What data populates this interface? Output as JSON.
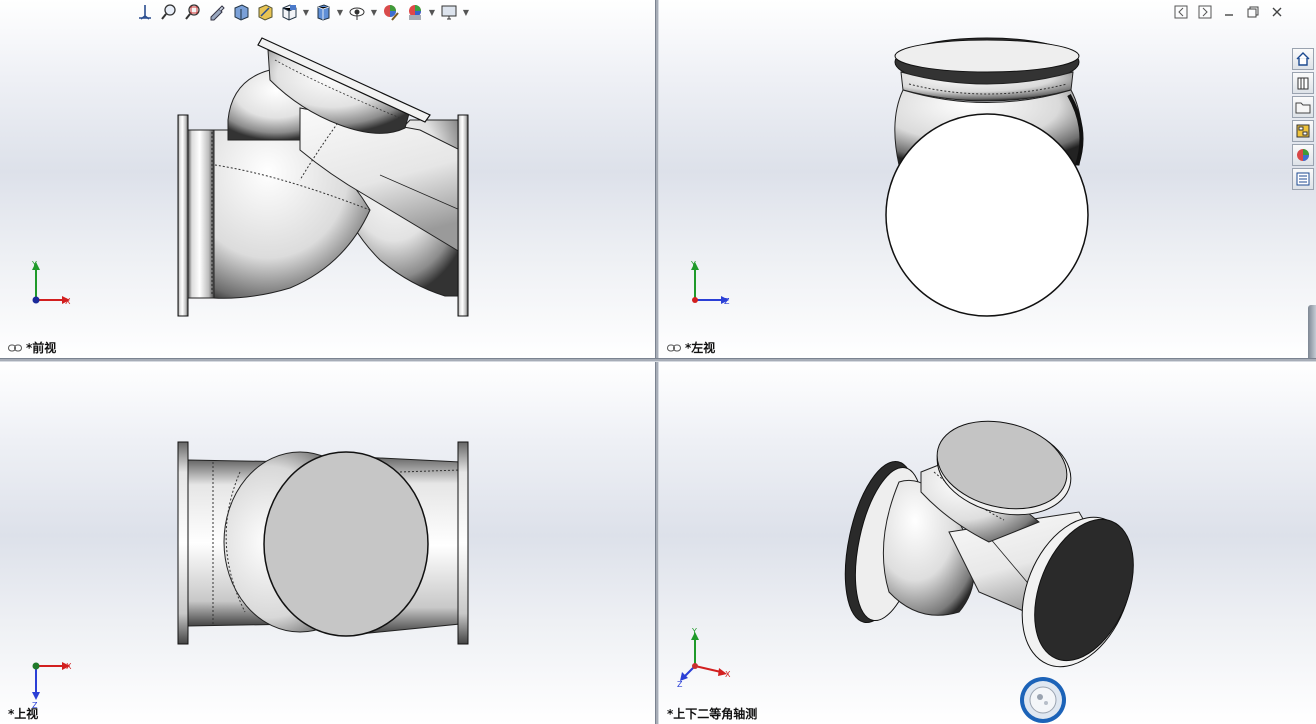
{
  "viewports": {
    "front": {
      "label": "*前视"
    },
    "left": {
      "label": "*左视"
    },
    "top": {
      "label": "*上视"
    },
    "iso": {
      "label": "*上下二等角轴测"
    }
  },
  "triads": {
    "front": {
      "v": "Y",
      "h": "X"
    },
    "left": {
      "v": "Y",
      "h": "Z"
    },
    "top": {
      "v": "Z",
      "h": "X"
    },
    "iso": {
      "v": "Y",
      "h": "X",
      "d": "Z"
    }
  },
  "heads_up_toolbar": {
    "icons": [
      "view-orientation-icon",
      "zoom-to-fit-icon",
      "zoom-to-area-icon",
      "previous-view-icon",
      "section-view-icon",
      "dynamic-annotation-icon",
      "view-orientation-icon",
      "display-style-icon",
      "hide-show-items-icon",
      "edit-appearance-icon",
      "apply-scene-icon",
      "view-settings-icon"
    ]
  },
  "window_controls": [
    "scroll-left-icon",
    "scroll-right-icon",
    "minimize-icon",
    "restore-icon",
    "close-icon"
  ],
  "task_pane": [
    "home-icon",
    "design-library-icon",
    "file-explorer-icon",
    "view-palette-icon",
    "appearances-icon",
    "custom-properties-icon"
  ],
  "colors": {
    "viewport_mid": "#dde1ea",
    "axis_x": "#d21f1f",
    "axis_y": "#1f9a2a",
    "axis_z": "#2a3fd6",
    "origin": "#1a2a9a",
    "splitter": "#a7adb7"
  }
}
